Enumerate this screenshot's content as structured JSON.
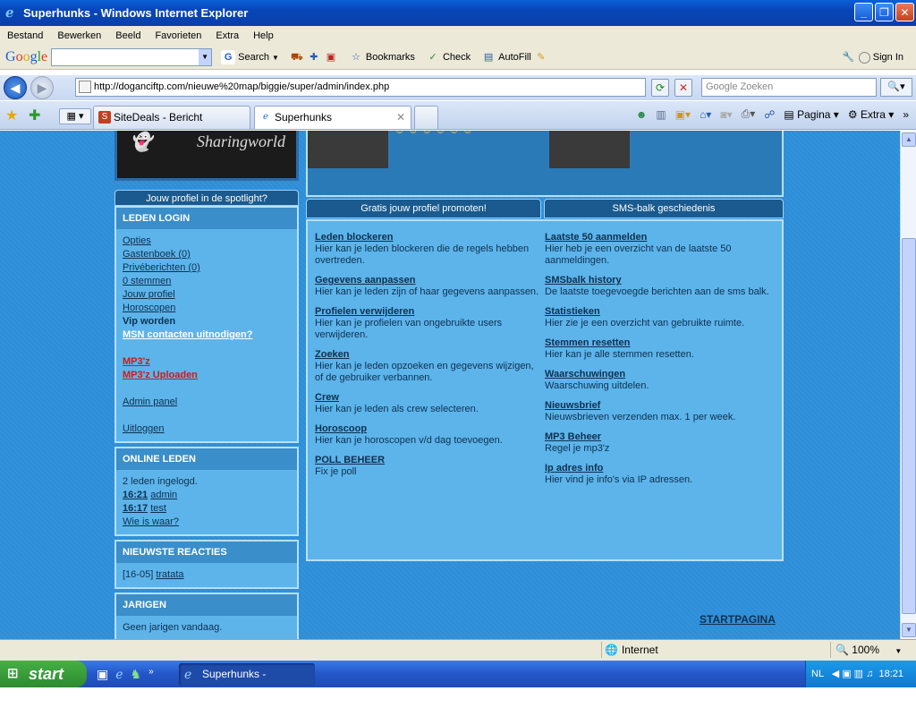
{
  "window": {
    "title": "Superhunks - Windows Internet Explorer",
    "min": "_",
    "max": "❐",
    "close": "✕"
  },
  "menu": [
    "Bestand",
    "Bewerken",
    "Beeld",
    "Favorieten",
    "Extra",
    "Help"
  ],
  "google_toolbar": {
    "search_label": "Search",
    "bookmarks_label": "Bookmarks",
    "check_label": "Check",
    "autofill_label": "AutoFill",
    "signin_label": "Sign In"
  },
  "address": {
    "url": "http://doganciftp.com/nieuwe%20map/biggie/super/admin/index.php",
    "search_placeholder": "Google Zoeken"
  },
  "tabs": [
    {
      "label": "SiteDeals - Bericht Aanpassen",
      "active": false
    },
    {
      "label": "Superhunks",
      "active": true
    }
  ],
  "tab_tools": {
    "page_label": "Pagina",
    "extra_label": "Extra"
  },
  "page": {
    "logo_text": "Sharingworld",
    "spotlight": "Jouw profiel in de spotlight?",
    "promote_btn": "Gratis jouw profiel promoten!",
    "sms_btn": "SMS-balk geschiedenis",
    "login_panel": {
      "title": "LEDEN LOGIN",
      "links": [
        {
          "label": "Opties",
          "style": "normal"
        },
        {
          "label": "Gastenboek (0)",
          "style": "normal"
        },
        {
          "label": "Privéberichten (0)",
          "style": "normal"
        },
        {
          "label": "0 stemmen",
          "style": "normal"
        },
        {
          "label": "Jouw profiel",
          "style": "normal"
        },
        {
          "label": "Horoscopen",
          "style": "normal"
        },
        {
          "label": "Vip worden",
          "style": "bold"
        },
        {
          "label": "MSN contacten uitnodigen?",
          "style": "white"
        },
        {
          "label": "",
          "style": "gap"
        },
        {
          "label": "MP3'z",
          "style": "red"
        },
        {
          "label": "MP3'z Uploaden",
          "style": "red"
        },
        {
          "label": "",
          "style": "gap"
        },
        {
          "label": "Admin panel",
          "style": "normal"
        },
        {
          "label": "",
          "style": "gap"
        },
        {
          "label": "Uitloggen",
          "style": "normal"
        }
      ]
    },
    "online_panel": {
      "title": "ONLINE LEDEN",
      "count_text": "2 leden ingelogd.",
      "users": [
        {
          "time": "16:21",
          "name": "admin"
        },
        {
          "time": "16:17",
          "name": "test"
        }
      ],
      "whois": "Wie is waar?"
    },
    "reacties_panel": {
      "title": "NIEUWSTE REACTIES",
      "date": "[16-05]",
      "item": "tratata"
    },
    "jarigen_panel": {
      "title": "JARIGEN",
      "text": "Geen jarigen vandaag."
    },
    "admin_left": [
      {
        "title": "Leden blockeren",
        "desc": "Hier kan je leden blockeren die de regels hebben overtreden."
      },
      {
        "title": "Gegevens aanpassen",
        "desc": "Hier kan je leden zijn of haar gegevens aanpassen."
      },
      {
        "title": "Profielen verwijderen",
        "desc": "Hier kan je profielen van ongebruikte users verwijderen."
      },
      {
        "title": "Zoeken",
        "desc": "Hier kan je leden opzoeken en gegevens wijzigen, of de gebruiker verbannen."
      },
      {
        "title": "Crew",
        "desc": "Hier kan je leden als crew selecteren."
      },
      {
        "title": "Horoscoop",
        "desc": "Hier kan je horoscopen v/d dag toevoegen."
      },
      {
        "title": "POLL BEHEER",
        "desc": "Fix je poll"
      }
    ],
    "admin_right": [
      {
        "title": "Laatste 50 aanmelden",
        "desc": "Hier heb je een overzicht van de laatste 50 aanmeldingen."
      },
      {
        "title": "SMSbalk history",
        "desc": "De laatste toegevoegde berichten aan de sms balk."
      },
      {
        "title": "Statistieken",
        "desc": "Hier zie je een overzicht van gebruikte ruimte."
      },
      {
        "title": "Stemmen resetten",
        "desc": "Hier kan je alle stemmen resetten."
      },
      {
        "title": "Waarschuwingen",
        "desc": "Waarschuwing uitdelen."
      },
      {
        "title": "Nieuwsbrief",
        "desc": "Nieuwsbrieven verzenden max. 1 per week."
      },
      {
        "title": "MP3 Beheer",
        "desc": "Regel je mp3'z"
      },
      {
        "title": "Ip adres info",
        "desc": "Hier vind je info's via IP adressen."
      }
    ],
    "startpagina": "STARTPAGINA"
  },
  "status": {
    "zone": "Internet",
    "zoom": "100%"
  },
  "taskbar": {
    "start": "start",
    "task": "Superhunks - Window...",
    "lang": "NL",
    "clock": "18:21"
  }
}
